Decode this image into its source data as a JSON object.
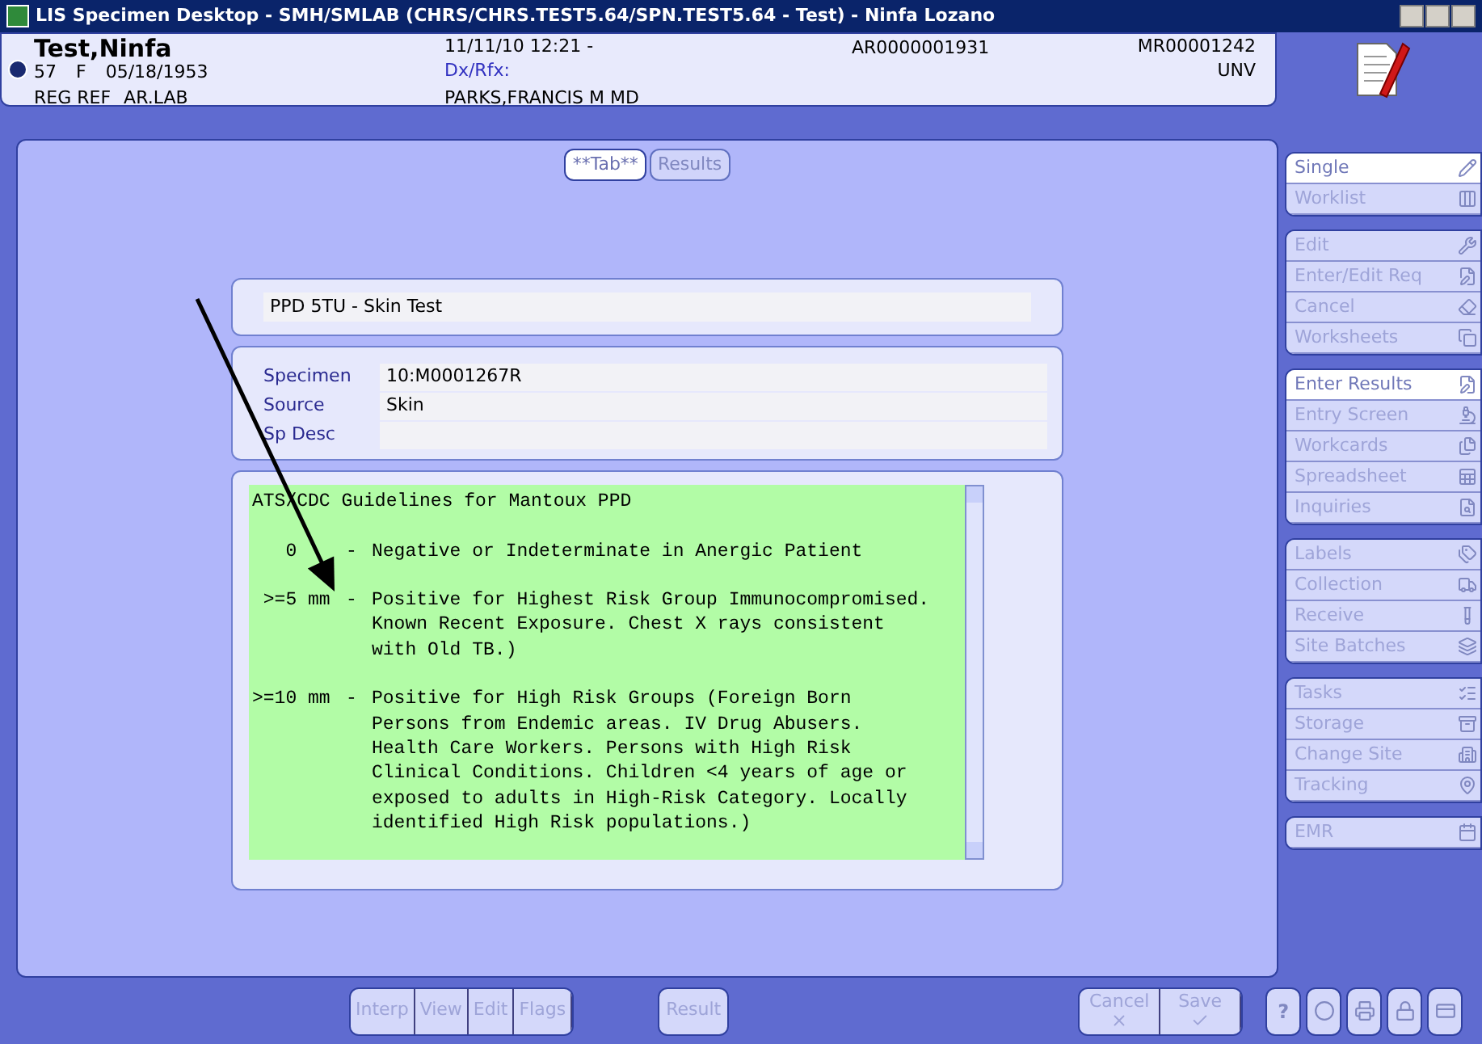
{
  "window": {
    "title": "LIS Specimen Desktop - SMH/SMLAB (CHRS/CHRS.TEST5.64/SPN.TEST5.64 - Test) - Ninfa Lozano"
  },
  "patient": {
    "name": "Test,Ninfa",
    "age": "57",
    "sex": "F",
    "dob": "05/18/1953",
    "reg": "REG REF",
    "location": "AR.LAB",
    "datetime": "11/11/10 12:21 -",
    "dx": "Dx/Rfx:",
    "doctor": "PARKS,FRANCIS M MD",
    "account": "AR0000001931",
    "mrn": "MR00001242",
    "status": "UNV"
  },
  "tabs": [
    {
      "label": "**Tab**",
      "selected": true
    },
    {
      "label": "Results",
      "selected": false
    }
  ],
  "test": {
    "name": "PPD 5TU - Skin Test"
  },
  "specimen_fields": [
    {
      "label": "Specimen",
      "value": "10:M0001267R"
    },
    {
      "label": "Source",
      "value": "Skin"
    },
    {
      "label": "Sp Desc"
    }
  ],
  "guidelines": {
    "title": "ATS/CDC Guidelines for Mantoux PPD",
    "entries": [
      {
        "range": "   0",
        "sep": "-",
        "text": "Negative or Indeterminate in Anergic Patient"
      },
      {
        "range": " >=5 mm",
        "sep": "-",
        "text": "Positive for Highest Risk Group Immunocompromised.\nKnown Recent Exposure. Chest X rays consistent\nwith Old TB.)"
      },
      {
        "range": ">=10 mm",
        "sep": "-",
        "text": "Positive for High Risk Groups (Foreign Born\nPersons from Endemic areas. IV Drug Abusers.\nHealth Care Workers. Persons with High Risk\nClinical Conditions. Children <4 years of age or\nexposed to adults in High-Risk Category. Locally\nidentified High Risk populations.)"
      }
    ]
  },
  "sidebar": {
    "groups": [
      [
        {
          "label": "Single",
          "selected": true
        },
        {
          "label": "Worklist",
          "selected": false
        }
      ],
      [
        {
          "label": "Edit",
          "selected": false
        },
        {
          "label": "Enter/Edit Req",
          "selected": false
        },
        {
          "label": "Cancel",
          "selected": false
        },
        {
          "label": "Worksheets",
          "selected": false
        }
      ],
      [
        {
          "label": "Enter Results",
          "selected": true
        },
        {
          "label": "Entry Screen",
          "selected": false
        },
        {
          "label": "Workcards",
          "selected": false
        },
        {
          "label": "Spreadsheet",
          "selected": false
        },
        {
          "label": "Inquiries",
          "selected": false
        }
      ],
      [
        {
          "label": "Labels",
          "selected": false
        },
        {
          "label": "Collection",
          "selected": false
        },
        {
          "label": "Receive",
          "selected": false
        },
        {
          "label": "Site Batches",
          "selected": false
        }
      ],
      [
        {
          "label": "Tasks",
          "selected": false
        },
        {
          "label": "Storage",
          "selected": false
        },
        {
          "label": "Change Site",
          "selected": false
        },
        {
          "label": "Tracking",
          "selected": false
        }
      ],
      [
        {
          "label": "EMR",
          "selected": false
        }
      ]
    ]
  },
  "bottom_bar": {
    "edit_buttons": [
      {
        "label": "Interp",
        "disabled": true
      },
      {
        "label": "View",
        "disabled": true
      },
      {
        "label": "Edit",
        "disabled": true
      },
      {
        "label": "Flags",
        "disabled": true
      }
    ],
    "result_button": {
      "label": "Result",
      "disabled": true
    },
    "action_buttons": [
      {
        "label": "Cancel",
        "kind": "cancel",
        "disabled": true
      },
      {
        "label": "Save",
        "kind": "save",
        "disabled": true
      }
    ],
    "help_label": "?"
  }
}
